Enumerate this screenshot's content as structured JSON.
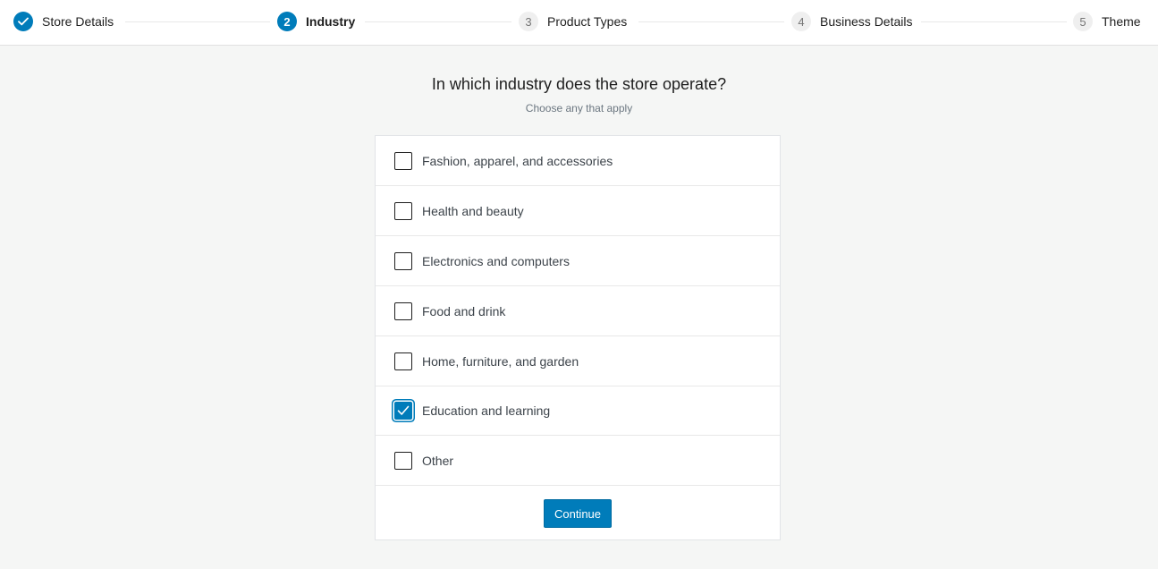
{
  "stepper": {
    "steps": [
      {
        "number": "",
        "label": "Store Details",
        "state": "done",
        "icon": "check-icon"
      },
      {
        "number": "2",
        "label": "Industry",
        "state": "current"
      },
      {
        "number": "3",
        "label": "Product Types",
        "state": "todo"
      },
      {
        "number": "4",
        "label": "Business Details",
        "state": "todo"
      },
      {
        "number": "5",
        "label": "Theme",
        "state": "todo"
      }
    ]
  },
  "main": {
    "title": "In which industry does the store operate?",
    "subtitle": "Choose any that apply",
    "options": [
      {
        "label": "Fashion, apparel, and accessories",
        "checked": false
      },
      {
        "label": "Health and beauty",
        "checked": false
      },
      {
        "label": "Electronics and computers",
        "checked": false
      },
      {
        "label": "Food and drink",
        "checked": false
      },
      {
        "label": "Home, furniture, and garden",
        "checked": false
      },
      {
        "label": "Education and learning",
        "checked": true
      },
      {
        "label": "Other",
        "checked": false
      }
    ],
    "continue_label": "Continue"
  },
  "colors": {
    "accent": "#007cba",
    "background": "#f5f6f5",
    "card": "#ffffff"
  }
}
